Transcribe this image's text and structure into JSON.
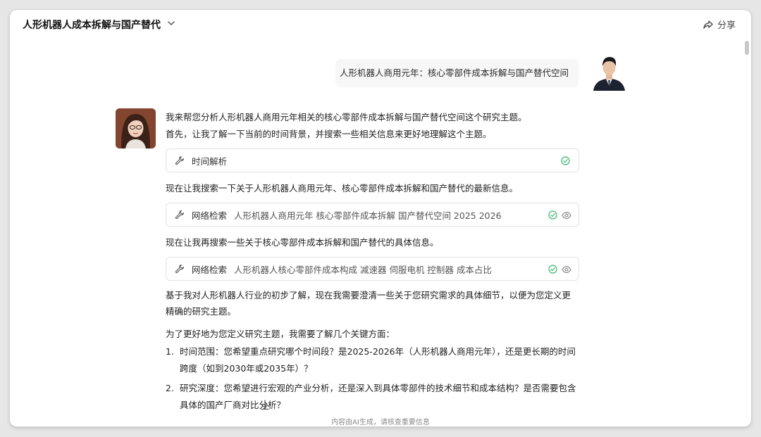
{
  "header": {
    "title": "人形机器人成本拆解与国产替代",
    "share_label": "分享"
  },
  "user_message": {
    "text": "人形机器人商用元年：核心零部件成本拆解与国产替代空间"
  },
  "ai": {
    "intro_1": "我来帮您分析人形机器人商用元年相关的核心零部件成本拆解与国产替代空间这个研究主题。",
    "intro_2": "首先，让我了解一下当前的时间背景，并搜索一些相关信息来更好地理解这个主题。",
    "tools": [
      {
        "name": "时间解析",
        "query": ""
      },
      {
        "name": "网络检索",
        "query": "人形机器人商用元年 核心零部件成本拆解 国产替代空间 2025 2026"
      },
      {
        "name": "网络检索",
        "query": "人形机器人核心零部件成本构成 减速器 伺服电机 控制器 成本占比"
      }
    ],
    "text_after_tool_1": "现在让我搜索一下关于人形机器人商用元年、核心零部件成本拆解和国产替代的最新信息。",
    "text_after_tool_2": "现在让我再搜索一些关于核心零部件成本拆解和国产替代的具体信息。",
    "para_3_line_1": "基于我对人形机器人行业的初步了解，现在我需要澄清一些关于您研究需求的具体细节，以便为您定义更",
    "para_3_line_2": "精确的研究主题。",
    "para_4": "为了更好地为您定义研究主题，我需要了解几个关键方面：",
    "list": [
      {
        "num": "1.",
        "line_1": "时间范围：您希望重点研究哪个时间段？是2025-2026年（人形机器人商用元年），还是更长期的时间",
        "line_2": "跨度（如到2030年或2035年）？"
      },
      {
        "num": "2.",
        "line_1": "研究深度：您希望进行宏观的产业分析，还是深入到具体零部件的技术细节和成本结构？是否需要包含",
        "line_2": "具体的国产厂商对比分析？"
      }
    ]
  },
  "footer": {
    "disclaimer": "内容由AI生成，请核查重要信息"
  },
  "icons": {
    "share": "share-icon",
    "chevron": "chevron-down-icon",
    "tool": "wrench-icon",
    "done": "check-circle-icon",
    "preview": "eye-icon",
    "scroll": "arrow-down-icon"
  },
  "colors": {
    "check_green": "#3cb46e",
    "user_bubble_bg": "#f7f7f8"
  }
}
